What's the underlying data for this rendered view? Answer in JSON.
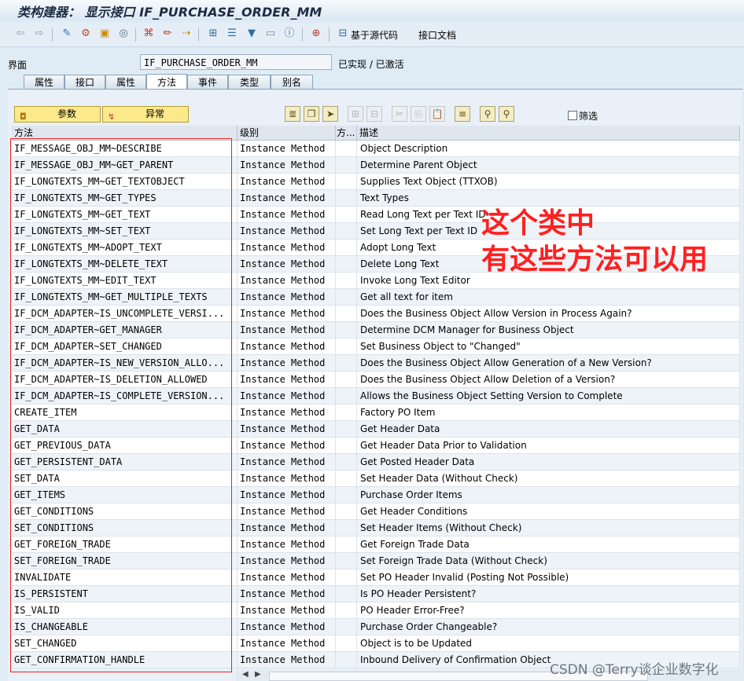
{
  "window": {
    "title": "类构建器： 显示接口 IF_PURCHASE_ORDER_MM"
  },
  "toolbar": {
    "icons": [
      "back-icon",
      "forward-icon",
      "other-object-icon",
      "display-change-icon",
      "activate-icon",
      "check-icon",
      "where-used-icon",
      "display-object-list-icon",
      "edit-icon",
      "navigate-icon",
      "hierarchy-icon",
      "documentation-icon",
      "filter-icon",
      "window-icon",
      "info-icon",
      "print-icon"
    ],
    "source_code_label": "基于源代码",
    "interface_doc_label": "接口文档"
  },
  "header": {
    "interface_label": "界面",
    "interface_value": "IF_PURCHASE_ORDER_MM",
    "status": "已实现 / 已激活"
  },
  "tabs": [
    {
      "label": "属性"
    },
    {
      "label": "接口"
    },
    {
      "label": "属性"
    },
    {
      "label": "方法"
    },
    {
      "label": "事件"
    },
    {
      "label": "类型"
    },
    {
      "label": "别名"
    }
  ],
  "actions": {
    "params_label": "参数",
    "exceptions_label": "异常",
    "filter_label": "筛选"
  },
  "grid": {
    "columns": [
      "方法",
      "级别",
      "方...",
      "描述"
    ],
    "rows": [
      [
        "IF_MESSAGE_OBJ_MM~DESCRIBE",
        "Instance Method",
        "Object Description"
      ],
      [
        "IF_MESSAGE_OBJ_MM~GET_PARENT",
        "Instance Method",
        "Determine Parent Object"
      ],
      [
        "IF_LONGTEXTS_MM~GET_TEXTOBJECT",
        "Instance Method",
        "Supplies Text Object (TTXOB)"
      ],
      [
        "IF_LONGTEXTS_MM~GET_TYPES",
        "Instance Method",
        "Text Types"
      ],
      [
        "IF_LONGTEXTS_MM~GET_TEXT",
        "Instance Method",
        "Read Long Text per Text ID"
      ],
      [
        "IF_LONGTEXTS_MM~SET_TEXT",
        "Instance Method",
        "Set Long Text per Text ID"
      ],
      [
        "IF_LONGTEXTS_MM~ADOPT_TEXT",
        "Instance Method",
        "Adopt Long Text"
      ],
      [
        "IF_LONGTEXTS_MM~DELETE_TEXT",
        "Instance Method",
        "Delete Long Text"
      ],
      [
        "IF_LONGTEXTS_MM~EDIT_TEXT",
        "Instance Method",
        "Invoke Long Text Editor"
      ],
      [
        "IF_LONGTEXTS_MM~GET_MULTIPLE_TEXTS",
        "Instance Method",
        "Get all text for item"
      ],
      [
        "IF_DCM_ADAPTER~IS_UNCOMPLETE_VERSI...",
        "Instance Method",
        "Does the Business Object Allow Version in Process Again?"
      ],
      [
        "IF_DCM_ADAPTER~GET_MANAGER",
        "Instance Method",
        "Determine DCM Manager for Business Object"
      ],
      [
        "IF_DCM_ADAPTER~SET_CHANGED",
        "Instance Method",
        "Set Business Object to \"Changed\""
      ],
      [
        "IF_DCM_ADAPTER~IS_NEW_VERSION_ALLO...",
        "Instance Method",
        "Does the Business Object Allow Generation of a New Version?"
      ],
      [
        "IF_DCM_ADAPTER~IS_DELETION_ALLOWED",
        "Instance Method",
        "Does the Business Object Allow Deletion of a Version?"
      ],
      [
        "IF_DCM_ADAPTER~IS_COMPLETE_VERSION...",
        "Instance Method",
        "Allows the Business Object Setting Version to Complete"
      ],
      [
        "CREATE_ITEM",
        "Instance Method",
        "Factory PO Item"
      ],
      [
        "GET_DATA",
        "Instance Method",
        "Get Header Data"
      ],
      [
        "GET_PREVIOUS_DATA",
        "Instance Method",
        "Get Header Data Prior to Validation"
      ],
      [
        "GET_PERSISTENT_DATA",
        "Instance Method",
        "Get Posted Header Data"
      ],
      [
        "SET_DATA",
        "Instance Method",
        "Set Header Data (Without Check)"
      ],
      [
        "GET_ITEMS",
        "Instance Method",
        "Purchase Order Items"
      ],
      [
        "GET_CONDITIONS",
        "Instance Method",
        "Get Header Conditions"
      ],
      [
        "SET_CONDITIONS",
        "Instance Method",
        "Set Header Items (Without Check)"
      ],
      [
        "GET_FOREIGN_TRADE",
        "Instance Method",
        "Get Foreign Trade Data"
      ],
      [
        "SET_FOREIGN_TRADE",
        "Instance Method",
        "Set Foreign Trade Data (Without Check)"
      ],
      [
        "INVALIDATE",
        "Instance Method",
        "Set PO Header Invalid (Posting Not Possible)"
      ],
      [
        "IS_PERSISTENT",
        "Instance Method",
        "Is PO Header Persistent?"
      ],
      [
        "IS_VALID",
        "Instance Method",
        "PO Header Error-Free?"
      ],
      [
        "IS_CHANGEABLE",
        "Instance Method",
        "Purchase Order Changeable?"
      ],
      [
        "SET_CHANGED",
        "Instance Method",
        "Object is to be Updated"
      ],
      [
        "GET_CONFIRMATION_HANDLE",
        "Instance Method",
        "Inbound Delivery of Confirmation Object"
      ]
    ]
  },
  "annotation": {
    "line1": "这个类中",
    "line2": "有这些方法可以用",
    "color": "#ff2020"
  },
  "watermark": "CSDN @Terry谈企业数字化"
}
